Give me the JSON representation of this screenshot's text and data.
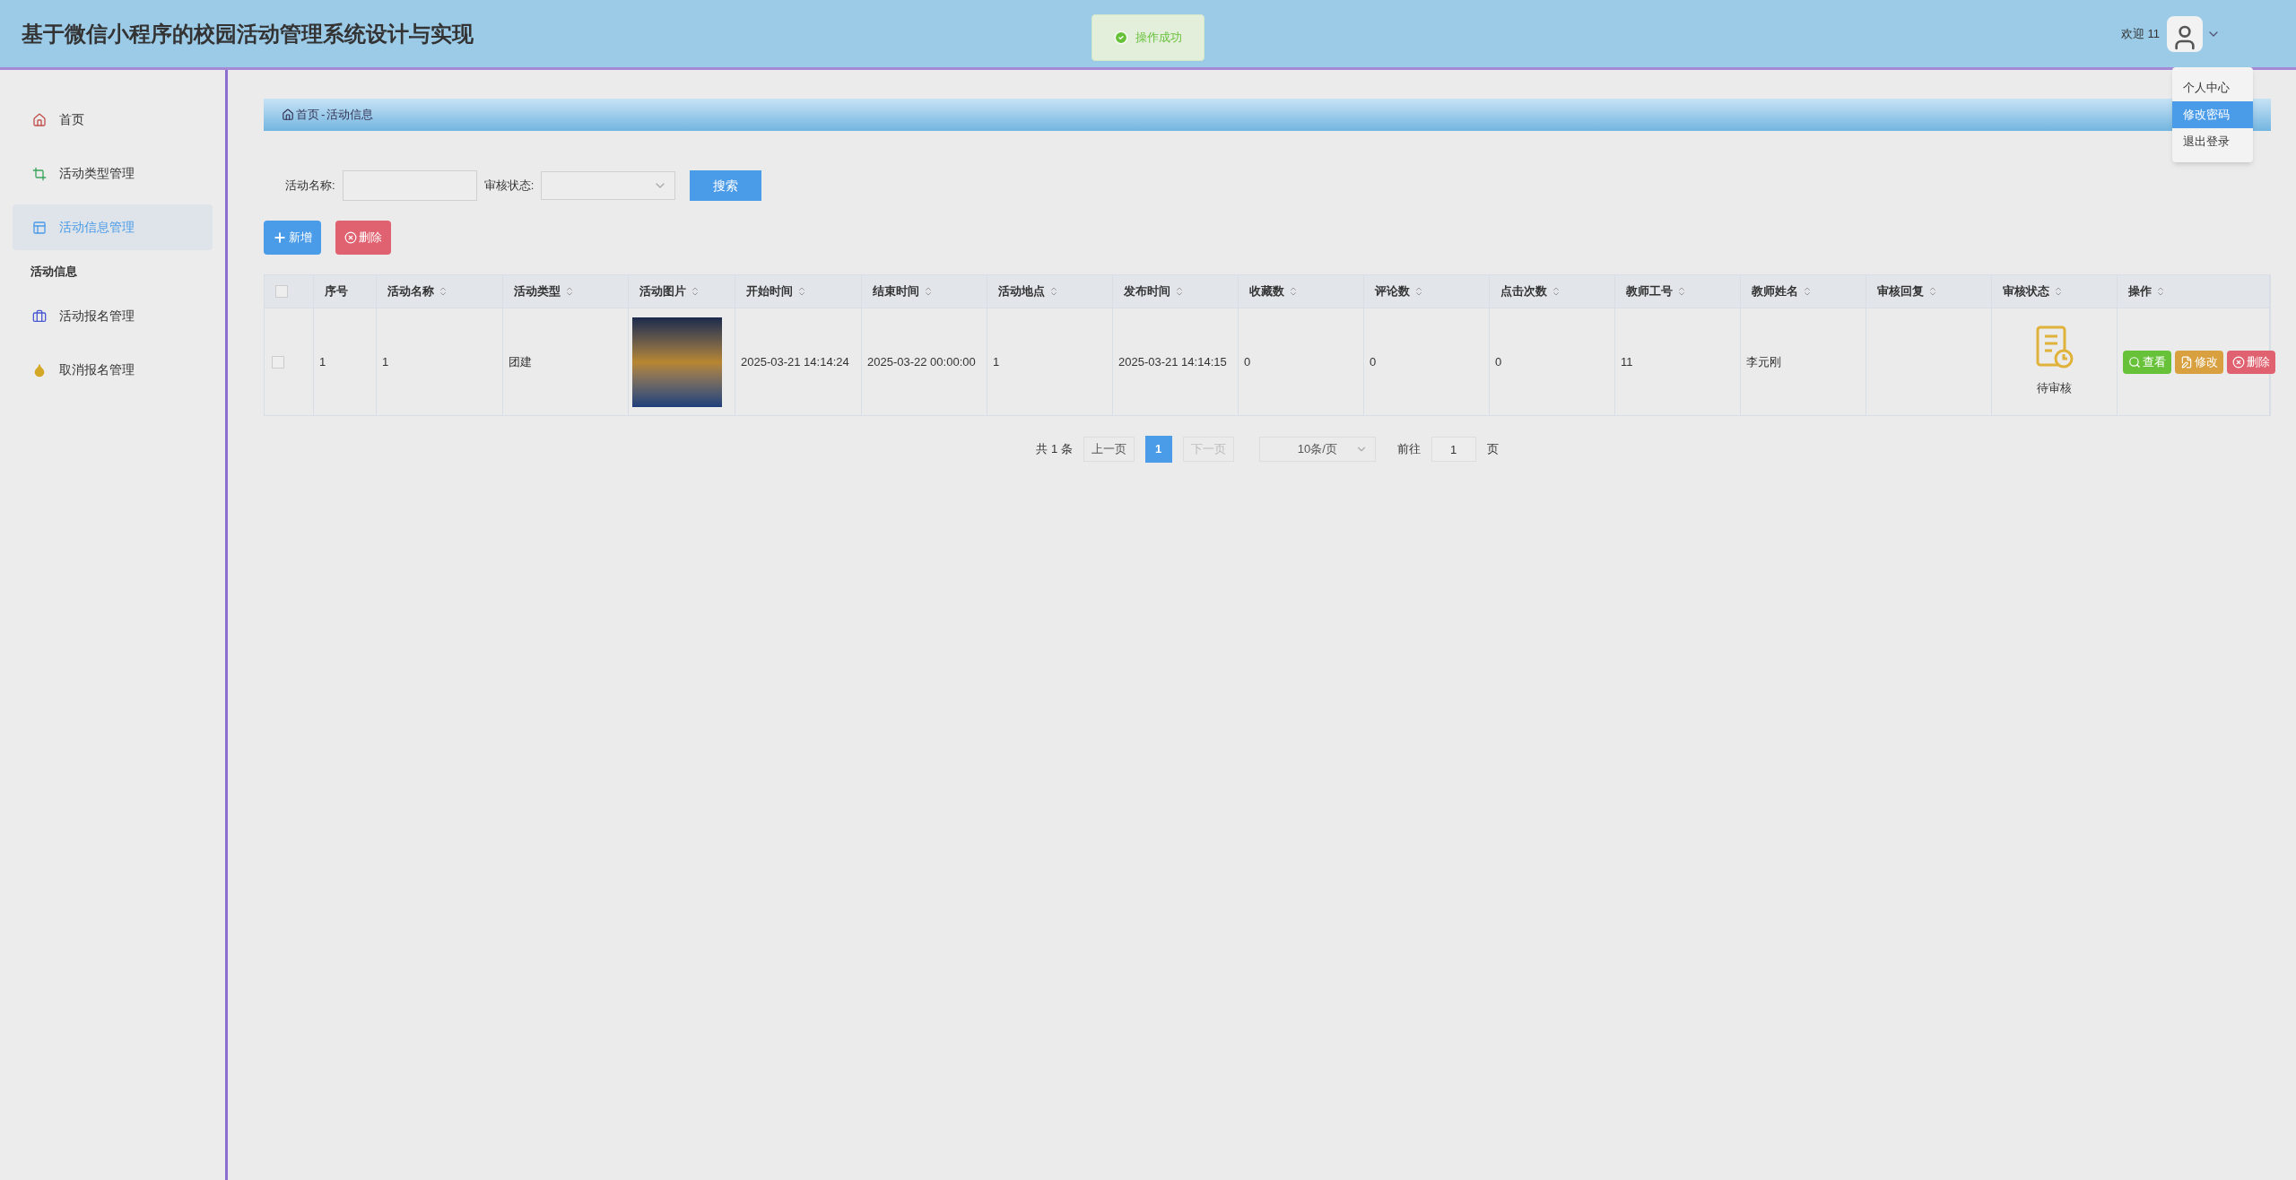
{
  "header": {
    "title": "基于微信小程序的校园活动管理系统设计与实现",
    "toast": "操作成功",
    "welcome": "欢迎 11"
  },
  "user_menu": [
    {
      "label": "个人中心",
      "selected": false
    },
    {
      "label": "修改密码",
      "selected": true
    },
    {
      "label": "退出登录",
      "selected": false
    }
  ],
  "sidebar": {
    "items": [
      {
        "kind": "item",
        "label": "首页",
        "selected": false
      },
      {
        "kind": "item",
        "label": "活动类型管理",
        "selected": false
      },
      {
        "kind": "item",
        "label": "活动信息管理",
        "selected": true
      },
      {
        "kind": "group",
        "label": "活动信息",
        "selected": false
      },
      {
        "kind": "item",
        "label": "活动报名管理",
        "selected": false
      },
      {
        "kind": "item",
        "label": "取消报名管理",
        "selected": false
      }
    ]
  },
  "breadcrumb": [
    "首页",
    "-",
    "活动信息"
  ],
  "search": {
    "fields": [
      {
        "kind": "input",
        "label": "活动名称:"
      },
      {
        "kind": "select",
        "label": "审核状态:"
      }
    ],
    "button": "搜索"
  },
  "actions": [
    {
      "kind": "add",
      "label": "新增"
    },
    {
      "kind": "delete",
      "label": "删除"
    }
  ],
  "table": {
    "select_all_checked": false,
    "columns": [
      {
        "label": "序号",
        "sortable": false
      },
      {
        "label": "活动名称",
        "sortable": true
      },
      {
        "label": "活动类型",
        "sortable": true
      },
      {
        "label": "活动图片",
        "sortable": true
      },
      {
        "label": "开始时间",
        "sortable": true
      },
      {
        "label": "结束时间",
        "sortable": true
      },
      {
        "label": "活动地点",
        "sortable": true
      },
      {
        "label": "发布时间",
        "sortable": true
      },
      {
        "label": "收藏数",
        "sortable": true
      },
      {
        "label": "评论数",
        "sortable": true
      },
      {
        "label": "点击次数",
        "sortable": true
      },
      {
        "label": "教师工号",
        "sortable": true
      },
      {
        "label": "教师姓名",
        "sortable": true
      },
      {
        "label": "审核回复",
        "sortable": true
      },
      {
        "label": "审核状态",
        "sortable": true
      },
      {
        "label": "操作",
        "sortable": true
      }
    ],
    "rows": [
      {
        "checked": false,
        "cells": [
          {
            "kind": "text",
            "text": "1"
          },
          {
            "kind": "text",
            "text": "1"
          },
          {
            "kind": "text",
            "text": "团建"
          },
          {
            "kind": "image"
          },
          {
            "kind": "text",
            "text": "2025-03-21 14:14:24"
          },
          {
            "kind": "text",
            "text": "2025-03-22 00:00:00"
          },
          {
            "kind": "text",
            "text": "1"
          },
          {
            "kind": "text",
            "text": "2025-03-21 14:14:15"
          },
          {
            "kind": "text",
            "text": "0"
          },
          {
            "kind": "text",
            "text": "0"
          },
          {
            "kind": "text",
            "text": "0"
          },
          {
            "kind": "text",
            "text": "11"
          },
          {
            "kind": "text",
            "text": "李元刚"
          },
          {
            "kind": "text",
            "text": ""
          },
          {
            "kind": "status",
            "text": "待审核"
          },
          {
            "kind": "actions",
            "buttons": [
              {
                "kind": "view",
                "label": "查看"
              },
              {
                "kind": "edit",
                "label": "修改"
              },
              {
                "kind": "delete",
                "label": "删除"
              }
            ]
          }
        ]
      }
    ]
  },
  "pagination": {
    "total": "共 1 条",
    "prev": {
      "label": "上一页",
      "disabled": false
    },
    "pages": [
      {
        "label": "1",
        "selected": true
      }
    ],
    "next": {
      "label": "下一页",
      "disabled": true
    },
    "page_size": "10条/页",
    "goto_label": "前往",
    "goto_value": "1",
    "goto_suffix": "页"
  }
}
